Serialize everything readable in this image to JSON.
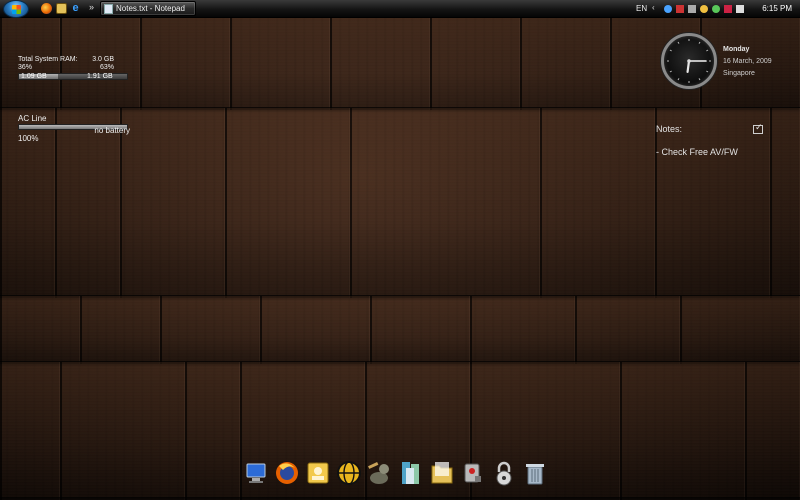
{
  "taskbar": {
    "start_button": "start-orb",
    "quick_launch": [
      "firefox-icon",
      "show-desktop-icon",
      "internet-explorer-icon"
    ],
    "overflow_label": "»",
    "active_task": {
      "label": "Notes.txt - Notepad",
      "icon": "notepad-icon"
    },
    "tray": {
      "language": "EN",
      "icons": [
        "bluetooth-icon",
        "network-icon",
        "security-icon",
        "update-icon",
        "volume-icon",
        "power-icon"
      ],
      "time": "6:15 PM"
    }
  },
  "ram_gadget": {
    "title": "Total System RAM:",
    "total": "3.0 GB",
    "used_pct_label": "36%",
    "free_pct_label": "63%",
    "used": "1.09 GB",
    "free": "1.91 GB",
    "used_fraction": 0.36
  },
  "battery_gadget": {
    "title": "AC Line",
    "status": "no battery",
    "percent_label": "100%",
    "level": 1.0
  },
  "clock_gadget": {
    "day": "Monday",
    "date": "16 March, 2009",
    "city": "Singapore",
    "time": {
      "hour": 6,
      "minute": 15
    }
  },
  "notes_gadget": {
    "title": "Notes:",
    "items": [
      "- Check Free AV/FW"
    ]
  },
  "dock": {
    "items": [
      "computer-icon",
      "firefox-icon",
      "contacts-icon",
      "browser-globe-icon",
      "gimp-icon",
      "library-icon",
      "folder-icon",
      "settings-tool-icon",
      "lock-icon",
      "recycle-bin-icon"
    ]
  },
  "colors": {
    "wood_dark": "#130b07",
    "wood_mid": "#4b3021",
    "taskbar": "#141414",
    "text": "#e6e6e6"
  }
}
